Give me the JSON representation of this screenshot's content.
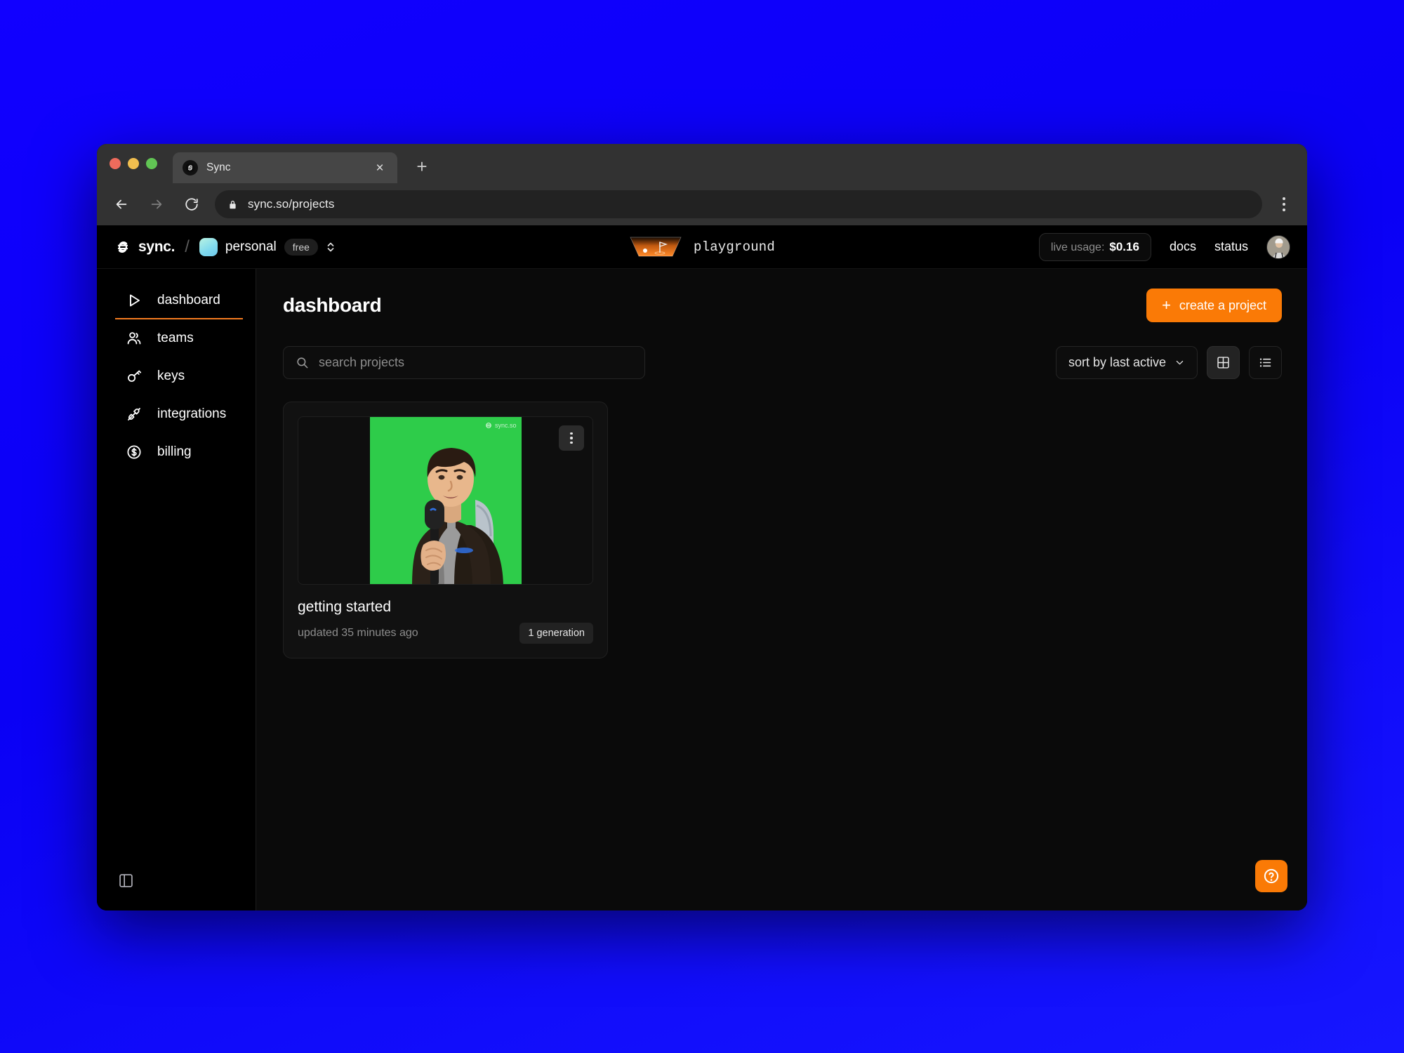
{
  "browser": {
    "tab": {
      "title": "Sync",
      "favicon": "sync-logo-icon",
      "close": "×"
    },
    "new_tab_label": "+",
    "url": "sync.so/projects",
    "back_icon": "arrow-left-icon",
    "forward_icon": "arrow-right-icon",
    "reload_icon": "reload-icon",
    "lock_icon": "lock-icon",
    "menu_icon": "kebab-menu-icon"
  },
  "header": {
    "brand": "sync.",
    "separator": "/",
    "workspace": {
      "name": "personal",
      "plan_badge": "free",
      "caret": "selector-icon"
    },
    "playground": {
      "label": "playground",
      "icon": "golf-green-icon"
    },
    "usage": {
      "label": "live usage:",
      "value": "$0.16"
    },
    "links": [
      {
        "label": "docs"
      },
      {
        "label": "status"
      }
    ],
    "avatar_alt": "user-avatar"
  },
  "sidebar": {
    "items": [
      {
        "label": "dashboard",
        "icon": "play-triangle-icon",
        "active": true
      },
      {
        "label": "teams",
        "icon": "people-icon",
        "active": false
      },
      {
        "label": "keys",
        "icon": "key-icon",
        "active": false
      },
      {
        "label": "integrations",
        "icon": "plug-icon",
        "active": false
      },
      {
        "label": "billing",
        "icon": "dollar-circle-icon",
        "active": false
      }
    ],
    "collapse_icon": "sidebar-collapse-icon"
  },
  "main": {
    "title": "dashboard",
    "create_button": {
      "label": "create a project",
      "plus": "+"
    },
    "search": {
      "placeholder": "search projects",
      "value": "",
      "icon": "search-icon"
    },
    "sort": {
      "label": "sort by last active",
      "caret": "chevron-down-icon"
    },
    "view_grid_icon": "grid-view-icon",
    "view_list_icon": "list-view-icon",
    "projects": [
      {
        "title": "getting started",
        "updated": "updated 35 minutes ago",
        "generations_badge": "1 generation",
        "thumbnail_watermark": "sync.so",
        "more_icon": "more-vertical-icon"
      }
    ]
  },
  "help": {
    "icon": "question-circle-icon"
  },
  "colors": {
    "accent_orange": "#fa7a06",
    "page_backdrop_blue": "#0b00ff",
    "app_background": "#0a0a0a",
    "thumbnail_green": "#2ecc4a",
    "workspace_avatar": "#7fd9ee"
  }
}
